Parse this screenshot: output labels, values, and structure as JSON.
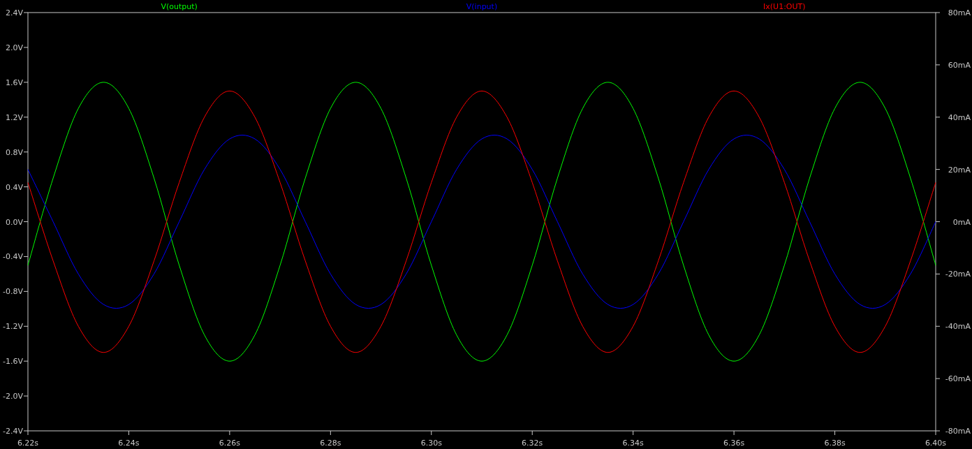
{
  "plot": {
    "chart_data": {
      "type": "line",
      "x": [
        6.22,
        6.225,
        6.23,
        6.235,
        6.24,
        6.245,
        6.25,
        6.255,
        6.26,
        6.265,
        6.27,
        6.275,
        6.28,
        6.285,
        6.29,
        6.295,
        6.3,
        6.305,
        6.31,
        6.315,
        6.32,
        6.325,
        6.33,
        6.335,
        6.34,
        6.345,
        6.35,
        6.355,
        6.36,
        6.365,
        6.37,
        6.375,
        6.38,
        6.385,
        6.39,
        6.395,
        6.4
      ],
      "xlim": [
        6.22,
        6.4
      ],
      "ylim": [
        -2.4,
        2.4
      ],
      "y2lim": [
        -80,
        80
      ],
      "xticks": [
        {
          "value": 6.22,
          "label": "6.22s"
        },
        {
          "value": 6.24,
          "label": "6.24s"
        },
        {
          "value": 6.26,
          "label": "6.26s"
        },
        {
          "value": 6.28,
          "label": "6.28s"
        },
        {
          "value": 6.3,
          "label": "6.30s"
        },
        {
          "value": 6.32,
          "label": "6.32s"
        },
        {
          "value": 6.34,
          "label": "6.34s"
        },
        {
          "value": 6.36,
          "label": "6.36s"
        },
        {
          "value": 6.38,
          "label": "6.38s"
        },
        {
          "value": 6.4,
          "label": "6.40s"
        }
      ],
      "yticks": [
        {
          "value": 2.4,
          "label": "2.4V"
        },
        {
          "value": 2.0,
          "label": "2.0V"
        },
        {
          "value": 1.6,
          "label": "1.6V"
        },
        {
          "value": 1.2,
          "label": "1.2V"
        },
        {
          "value": 0.8,
          "label": "0.8V"
        },
        {
          "value": 0.4,
          "label": "0.4V"
        },
        {
          "value": 0,
          "label": "0.0V"
        },
        {
          "value": -0.4,
          "label": "-0.4V"
        },
        {
          "value": -0.8,
          "label": "-0.8V"
        },
        {
          "value": -1.2,
          "label": "-1.2V"
        },
        {
          "value": -1.6,
          "label": "-1.6V"
        },
        {
          "value": -2.0,
          "label": "-2.0V"
        },
        {
          "value": -2.4,
          "label": "-2.4V"
        }
      ],
      "y2ticks": [
        {
          "value": 80,
          "label": "80mA"
        },
        {
          "value": 60,
          "label": "60mA"
        },
        {
          "value": 40,
          "label": "40mA"
        },
        {
          "value": 20,
          "label": "20mA"
        },
        {
          "value": 0,
          "label": "0mA"
        },
        {
          "value": -20,
          "label": "-20mA"
        },
        {
          "value": -40,
          "label": "-40mA"
        },
        {
          "value": -60,
          "label": "-60mA"
        },
        {
          "value": -80,
          "label": "-80mA"
        }
      ],
      "series": [
        {
          "name": "V(output)",
          "color": "#00ff00",
          "values": [
            -0.5,
            0.5,
            1.3,
            1.6,
            1.3,
            0.5,
            -0.5,
            -1.3,
            -1.6,
            -1.3,
            -0.5,
            0.5,
            1.3,
            1.6,
            1.3,
            0.5,
            -0.5,
            -1.3,
            -1.6,
            -1.3,
            -0.5,
            0.5,
            1.3,
            1.6,
            1.3,
            0.5,
            -0.5,
            -1.3,
            -1.6,
            -1.3,
            -0.5,
            0.5,
            1.3,
            1.6,
            1.3,
            0.5,
            -0.5
          ]
        },
        {
          "name": "V(input)",
          "color": "#0000ff",
          "values": [
            0.6,
            0,
            -0.6,
            -0.95,
            -0.95,
            -0.6,
            0,
            0.6,
            0.95,
            0.95,
            0.6,
            0,
            -0.6,
            -0.95,
            -0.95,
            -0.6,
            0,
            0.6,
            0.95,
            0.95,
            0.6,
            0,
            -0.6,
            -0.95,
            -0.95,
            -0.6,
            0,
            0.6,
            0.95,
            0.95,
            0.6,
            0,
            -0.6,
            -0.95,
            -0.95,
            -0.6,
            0
          ]
        },
        {
          "name": "Ix(U1:OUT)",
          "color": "#ff0000",
          "axis": "y2",
          "values": [
            15,
            -15,
            -40,
            -50,
            -40,
            -15,
            15,
            40,
            50,
            40,
            15,
            -15,
            -40,
            -50,
            -40,
            -15,
            15,
            40,
            50,
            40,
            15,
            -15,
            -40,
            -50,
            -40,
            -15,
            15,
            40,
            50,
            40,
            15,
            -15,
            -40,
            -50,
            -40,
            -15,
            15
          ]
        }
      ]
    }
  }
}
